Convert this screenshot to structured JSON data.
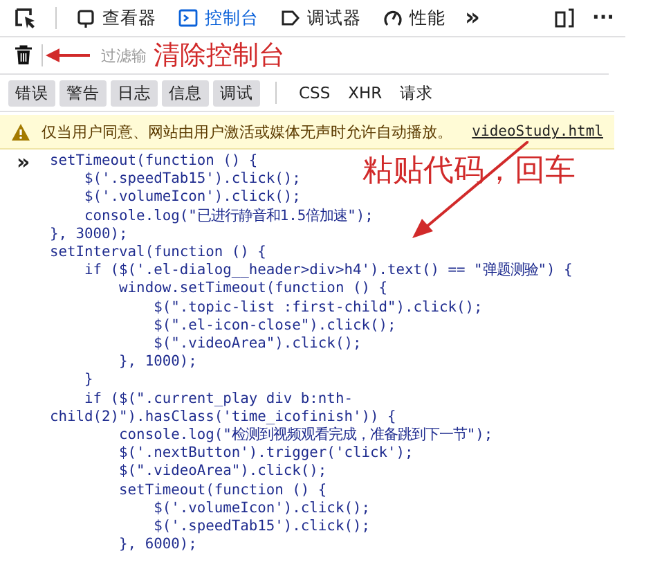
{
  "toolbar": {
    "tabs": [
      {
        "label": "查看器",
        "kind": "inspector",
        "selected": false
      },
      {
        "label": "控制台",
        "kind": "console",
        "selected": true
      },
      {
        "label": "调试器",
        "kind": "debugger",
        "selected": false
      },
      {
        "label": "性能",
        "kind": "performance",
        "selected": false
      }
    ],
    "overflow": "»",
    "menu": "···"
  },
  "filter_bar": {
    "placeholder": "过滤输",
    "annotation": "清除控制台"
  },
  "filters": [
    {
      "label": "错误",
      "on": true
    },
    {
      "label": "警告",
      "on": true
    },
    {
      "label": "日志",
      "on": true
    },
    {
      "label": "信息",
      "on": true
    },
    {
      "label": "调试",
      "on": true
    },
    {
      "label": "CSS",
      "on": false
    },
    {
      "label": "XHR",
      "on": false
    },
    {
      "label": "请求",
      "on": false
    }
  ],
  "warning": {
    "message": "仅当用户同意、网站由用户激活或媒体无声时允许自动播放。",
    "source": "videoStudy.html"
  },
  "console": {
    "prompt": "»",
    "annotation": "粘贴代码，回车",
    "lines": [
      "setTimeout(function () {",
      "    $('.speedTab15').click();",
      "    $('.volumeIcon').click();",
      "    console.log(\"已进行静音和1.5倍加速\");",
      "}, 3000);",
      "setInterval(function () {",
      "    if ($('.el-dialog__header>div>h4').text() == \"弹题测验\") {",
      "        window.setTimeout(function () {",
      "            $(\".topic-list :first-child\").click();",
      "            $(\".el-icon-close\").click();",
      "            $(\".videoArea\").click();",
      "        }, 1000);",
      "    }",
      "    if ($(\".current_play div b:nth-",
      "child(2)\").hasClass('time_icofinish')) {",
      "        console.log(\"检测到视频观看完成，准备跳到下一节\");",
      "        $('.nextButton').trigger('click');",
      "        $(\".videoArea\").click();",
      "        setTimeout(function () {",
      "            $('.volumeIcon').click();",
      "            $('.speedTab15').click();",
      "        }, 6000);"
    ]
  }
}
